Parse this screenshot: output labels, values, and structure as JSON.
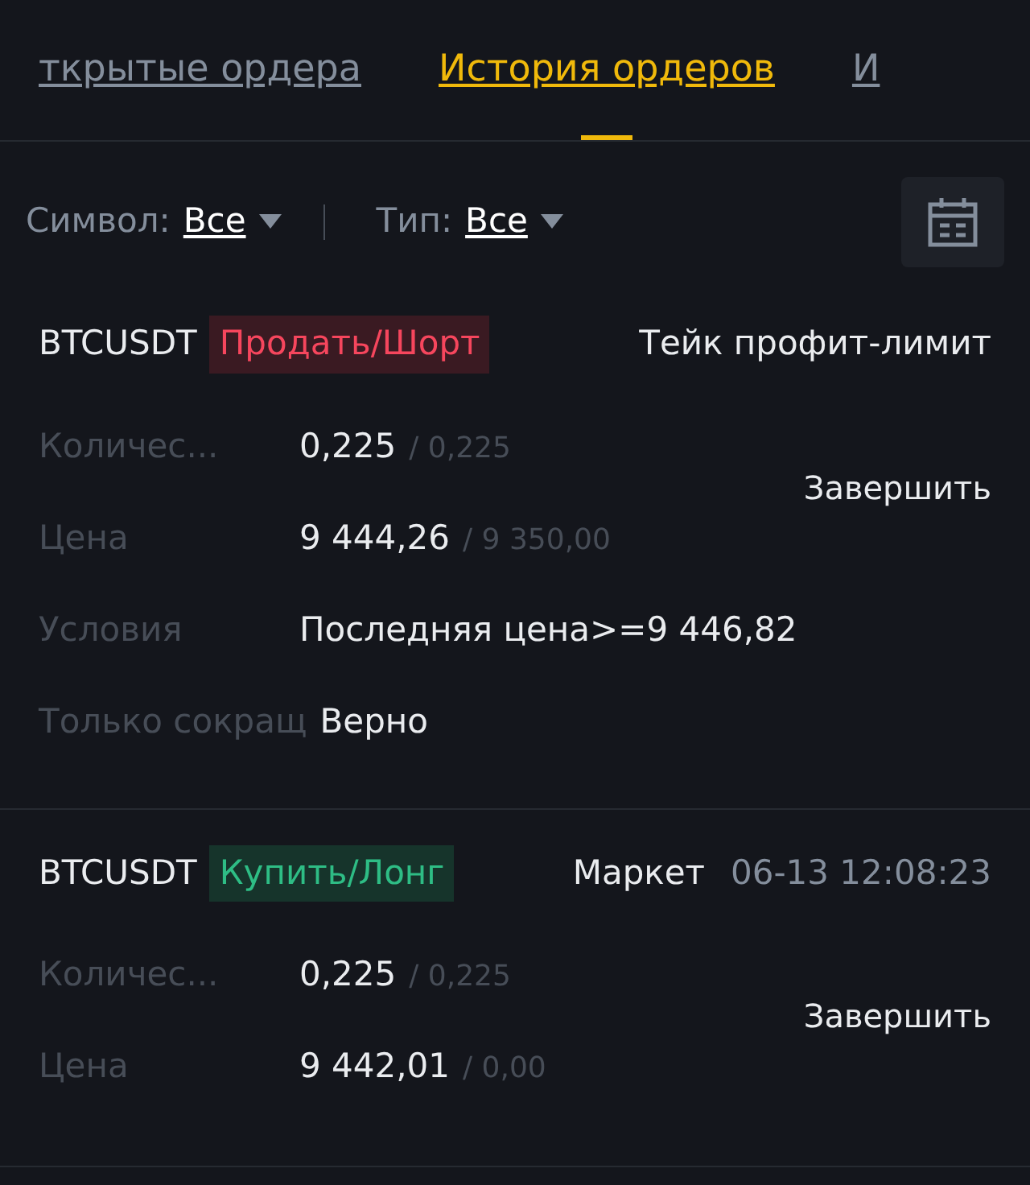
{
  "tabs": [
    {
      "label": "ткрытые ордера",
      "selected": false
    },
    {
      "label": "История ордеров",
      "selected": true
    },
    {
      "label": "И",
      "selected": false
    }
  ],
  "filters": [
    {
      "label": "Символ:",
      "value": "Все"
    },
    {
      "label": "Тип:",
      "value": "Все"
    }
  ],
  "orders": [
    {
      "symbol": "BTCUSDT",
      "side": "Продать/Шорт",
      "kind": "sell",
      "type": "Тейк профит-лимит",
      "action": "Завершить",
      "fields": [
        {
          "label": "Количес...",
          "value": "0,225",
          "total": "/ 0,225"
        },
        {
          "label": "Цена",
          "value": "9 444,26",
          "total": "/ 9 350,00"
        },
        {
          "label": "Условия",
          "value": "Последняя цена>=9 446,82"
        },
        {
          "label": "Только сокращ",
          "value": "Верно"
        }
      ]
    },
    {
      "symbol": "BTCUSDT",
      "side": "Купить/Лонг",
      "kind": "buy",
      "type": "Маркет",
      "time": "06-13 12:08:23",
      "action": "Завершить",
      "fields": [
        {
          "label": "Количес...",
          "value": "0,225",
          "total": "/ 0,225"
        },
        {
          "label": "Цена",
          "value": "9 442,01",
          "total": "/ 0,00"
        }
      ]
    }
  ]
}
